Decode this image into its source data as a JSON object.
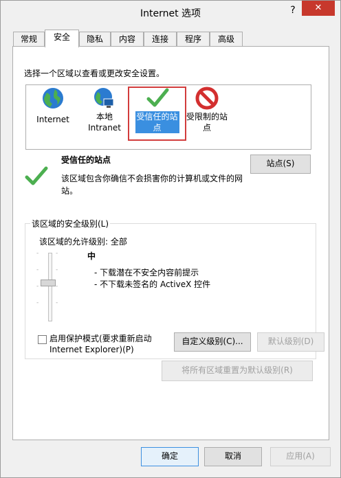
{
  "window": {
    "title": "Internet 选项",
    "help_glyph": "?",
    "close_glyph": "✕"
  },
  "tabs": [
    {
      "label": "常规"
    },
    {
      "label": "安全"
    },
    {
      "label": "隐私"
    },
    {
      "label": "内容"
    },
    {
      "label": "连接"
    },
    {
      "label": "程序"
    },
    {
      "label": "高级"
    }
  ],
  "security": {
    "zone_prompt": "选择一个区域以查看或更改安全设置。",
    "zones": [
      {
        "label_line1": "Internet",
        "label_line2": "",
        "icon": "globe-icon"
      },
      {
        "label_line1": "本地",
        "label_line2": "Intranet",
        "icon": "globe-network-icon"
      },
      {
        "label_line1": "受信任的站",
        "label_line2": "点",
        "icon": "checkmark-icon"
      },
      {
        "label_line1": "受限制的站",
        "label_line2": "点",
        "icon": "no-entry-icon"
      }
    ],
    "selected_zone": {
      "title": "受信任的站点",
      "description": "该区域包含你确信不会损害你的计算机或文件的网站。",
      "sites_button": "站点(S)"
    },
    "level_group": {
      "legend": "该区域的安全级别(L)",
      "allowed_level": "该区域的允许级别: 全部",
      "level_name": "中",
      "bullets": [
        "- 下载潜在不安全内容前提示",
        "- 不下载未签名的 ActiveX 控件"
      ],
      "protected_mode_line1": "启用保护模式(要求重新启动",
      "protected_mode_line2": "Internet Explorer)(P)",
      "protected_mode_checked": false,
      "custom_button": "自定义级别(C)...",
      "default_button": "默认级别(D)"
    },
    "reset_all_button": "将所有区域重置为默认级别(R)"
  },
  "footer": {
    "ok": "确定",
    "cancel": "取消",
    "apply": "应用(A)"
  },
  "colors": {
    "accent": "#3a8fe0",
    "highlight_border": "#d23c3c",
    "close_bg": "#c7382c",
    "check": "#4caf50"
  }
}
